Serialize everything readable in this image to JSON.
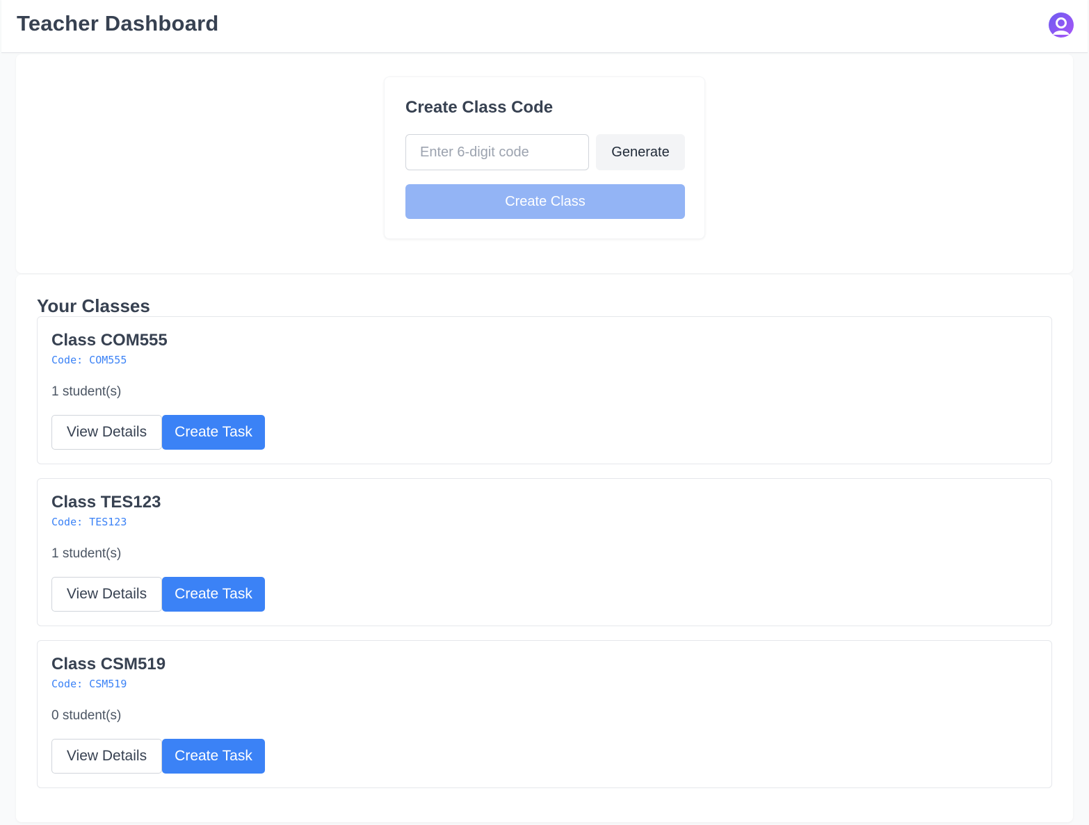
{
  "header": {
    "title": "Teacher Dashboard",
    "avatar_icon": "user-icon"
  },
  "create_class": {
    "title": "Create Class Code",
    "code_input": {
      "value": "",
      "placeholder": "Enter 6-digit code"
    },
    "generate_label": "Generate",
    "create_label": "Create Class",
    "create_disabled": true
  },
  "classes": {
    "heading": "Your Classes",
    "items": [
      {
        "name": "Class COM555",
        "code_text": "Code: COM555",
        "students": "1 student(s)",
        "view_label": "View Details",
        "task_label": "Create Task"
      },
      {
        "name": "Class TES123",
        "code_text": "Code: TES123",
        "students": "1 student(s)",
        "view_label": "View Details",
        "task_label": "Create Task"
      },
      {
        "name": "Class CSM519",
        "code_text": "Code: CSM519",
        "students": "0 student(s)",
        "view_label": "View Details",
        "task_label": "Create Task"
      }
    ]
  },
  "colors": {
    "primary": "#3b82f6",
    "primary_disabled": "#93b4f5",
    "text": "#374151",
    "border": "#e5e7eb",
    "avatar_gradient_start": "#6d5cf0",
    "avatar_gradient_end": "#a855f7"
  }
}
